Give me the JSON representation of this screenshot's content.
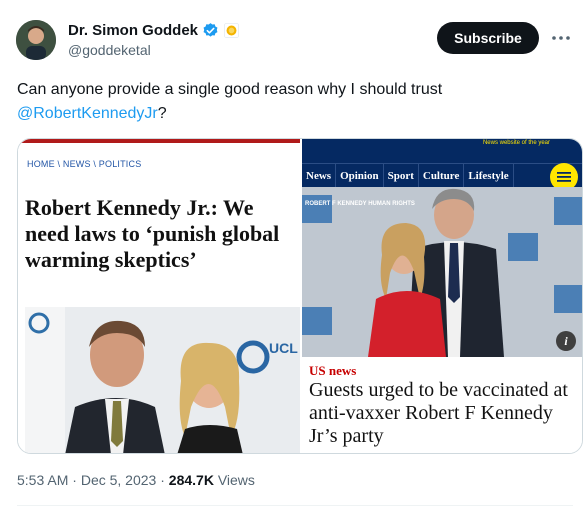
{
  "author": {
    "display_name": "Dr. Simon Goddek",
    "handle": "@goddeketal"
  },
  "actions": {
    "subscribe_label": "Subscribe",
    "more_icon": "more-horizontal-icon"
  },
  "tweet": {
    "text_before": "Can anyone provide a single good reason why I should trust ",
    "mention": "@RobertKennedyJr",
    "text_after": "?"
  },
  "left_card": {
    "breadcrumb": "HOME \\ NEWS \\ POLITICS",
    "headline": "Robert Kennedy Jr.: We need laws to ‘punish global warming skeptics’",
    "photo_text": "UCL"
  },
  "right_card": {
    "tagline": "News website of the year",
    "nav": [
      "News",
      "Opinion",
      "Sport",
      "Culture",
      "Lifestyle"
    ],
    "photo_text": "ROBERT F KENNEDY HUMAN RIGHTS",
    "section": "US news",
    "headline": "Guests urged to be vaccinated at anti-vaxxer Robert F Kennedy Jr’s party"
  },
  "meta": {
    "time": "5:53 AM",
    "date": "Dec 5, 2023",
    "separator": "·",
    "views_count": "284.7K",
    "views_label": "Views"
  },
  "colors": {
    "verified_blue": "#1d9bf0",
    "guardian_blue": "#052962",
    "guardian_yellow": "#ffe500",
    "us_news_red": "#c70000"
  }
}
